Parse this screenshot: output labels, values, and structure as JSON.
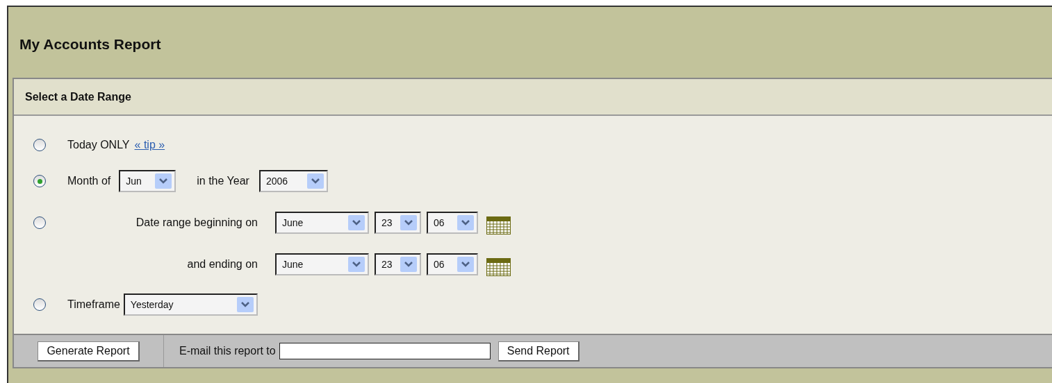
{
  "title": "My Accounts Report",
  "section": {
    "title": "Select a Date Range"
  },
  "options": [
    {
      "kind": "today",
      "selected": false,
      "label": "Today ONLY",
      "link": "« tip »"
    },
    {
      "kind": "month",
      "selected": true,
      "label": "Month of",
      "month": "Jun",
      "year_label": "in the Year",
      "year": "2006"
    },
    {
      "kind": "range",
      "selected": false,
      "label": "Date range beginning on",
      "start": {
        "month": "June",
        "day": "23",
        "year": "06"
      },
      "end_label": "and ending on",
      "end": {
        "month": "June",
        "day": "23",
        "year": "06"
      }
    },
    {
      "kind": "timeframe",
      "selected": false,
      "label": "Timeframe",
      "value": "Yesterday"
    }
  ],
  "footer": {
    "generate": "Generate Report",
    "email_label": "E-mail this report to",
    "send": "Send Report"
  }
}
